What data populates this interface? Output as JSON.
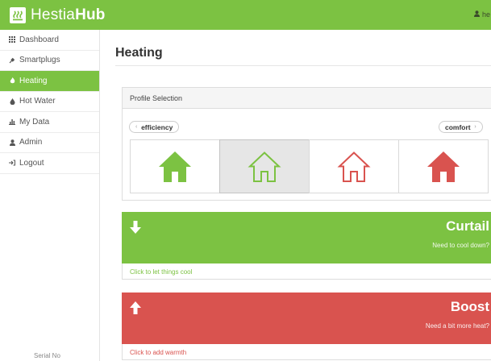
{
  "colors": {
    "brand_green": "#7cc242",
    "boost_red": "#d9534f"
  },
  "app": {
    "name_light": "Hestia",
    "name_bold": "Hub"
  },
  "user": {
    "label": "he"
  },
  "sidebar": {
    "items": [
      {
        "label": "Dashboard",
        "icon": "grid-icon"
      },
      {
        "label": "Smartplugs",
        "icon": "plug-icon"
      },
      {
        "label": "Heating",
        "icon": "flame-icon",
        "active": true
      },
      {
        "label": "Hot Water",
        "icon": "droplet-icon"
      },
      {
        "label": "My Data",
        "icon": "bar-chart-icon"
      },
      {
        "label": "Admin",
        "icon": "user-icon"
      },
      {
        "label": "Logout",
        "icon": "logout-icon"
      }
    ],
    "footer": "Serial No"
  },
  "page": {
    "title": "Heating"
  },
  "profile": {
    "heading": "Profile Selection",
    "left_label": "efficiency",
    "right_label": "comfort",
    "selected_index": 1,
    "options": [
      {
        "icon": "house-icon",
        "style": "solid",
        "color": "#7cc242"
      },
      {
        "icon": "house-outline-icon",
        "style": "outline",
        "color": "#7cc242"
      },
      {
        "icon": "house-outline-icon",
        "style": "outline",
        "color": "#d9534f"
      },
      {
        "icon": "house-icon",
        "style": "solid",
        "color": "#d9534f"
      }
    ]
  },
  "curtail": {
    "title": "Curtail",
    "subtitle": "Need to cool down?",
    "link": "Click to let things cool"
  },
  "boost": {
    "title": "Boost",
    "subtitle": "Need a bit more heat?",
    "link": "Click to add warmth"
  }
}
